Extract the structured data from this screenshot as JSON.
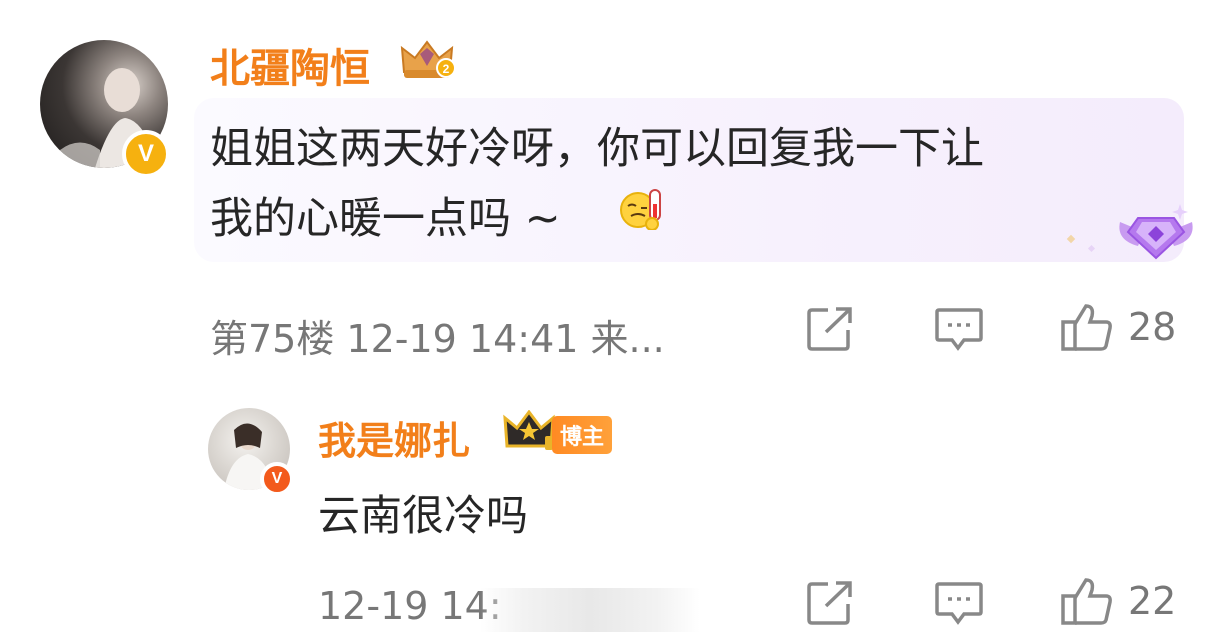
{
  "comment1": {
    "username": "北疆陶恒",
    "text_line1": "姐姐这两天好冷呀，你可以回复我一下让",
    "text_line2": "我的心暖一点吗 ~",
    "floor_meta": "第75楼 12-19 14:41 来...",
    "like_count": "28",
    "badge_icon": "crown-level-icon",
    "avatar_badge": "V"
  },
  "reply1": {
    "username": "我是娜扎",
    "author_tag": "博主",
    "text": "云南很冷吗",
    "meta": "12-19 14:",
    "like_count": "22",
    "avatar_badge": "V"
  },
  "colors": {
    "username": "#f27f1a",
    "meta_gray": "#777777",
    "badge_gold": "#f6b10f",
    "bubble_purple": "#f4ecfc"
  }
}
